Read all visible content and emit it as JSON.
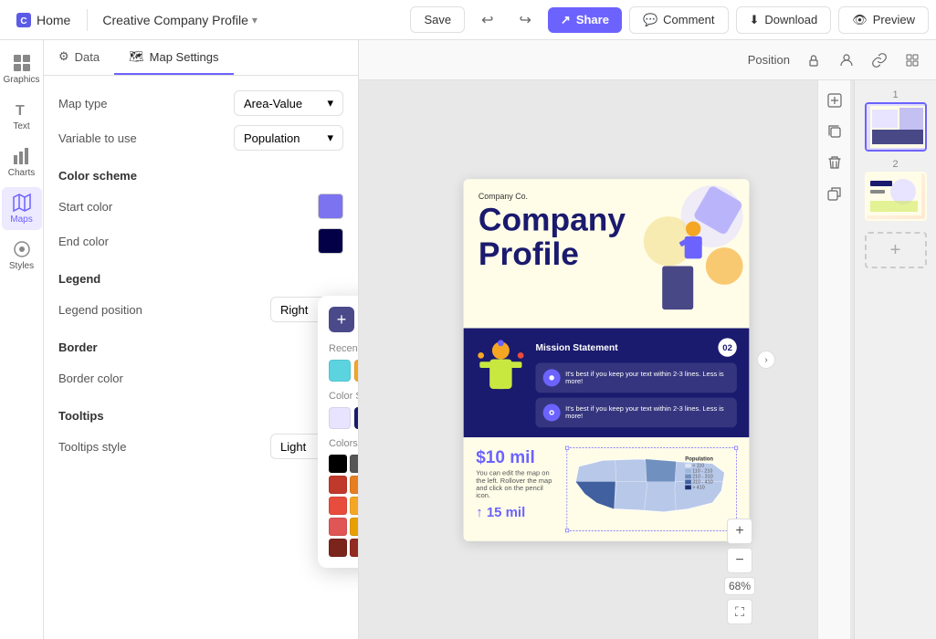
{
  "topbar": {
    "home_label": "Home",
    "title": "Creative Company Profile",
    "save_label": "Save",
    "share_label": "Share",
    "comment_label": "Comment",
    "download_label": "Download",
    "preview_label": "Preview"
  },
  "icon_sidebar": {
    "items": [
      {
        "id": "graphics",
        "label": "Graphics",
        "icon": "◻"
      },
      {
        "id": "text",
        "label": "Text",
        "icon": "T"
      },
      {
        "id": "charts",
        "label": "Charts",
        "icon": "📊"
      },
      {
        "id": "maps",
        "label": "Maps",
        "icon": "🗺"
      },
      {
        "id": "styles",
        "label": "Styles",
        "icon": "✦"
      }
    ]
  },
  "settings": {
    "tab_data": "Data",
    "tab_map_settings": "Map Settings",
    "map_type_label": "Map type",
    "map_type_value": "Area-Value",
    "variable_label": "Variable to use",
    "variable_value": "Population",
    "color_scheme_title": "Color scheme",
    "start_color_label": "Start color",
    "start_color_hex": "#7b73f0",
    "end_color_label": "End color",
    "end_color_hex": "#030047",
    "legend_title": "Legend",
    "legend_position_label": "Legend position",
    "legend_position_value": "Right",
    "border_title": "Border",
    "border_color_label": "Border color",
    "tooltips_title": "Tooltips",
    "tooltips_style_label": "Tooltips style",
    "tooltips_style_value": "Light"
  },
  "color_picker": {
    "hex_value": "#030047",
    "plus_label": "+",
    "recent_colors_label": "Recent Colors",
    "scheme_label": "Color Scheme - Original",
    "colors_label": "Colors",
    "recent": [
      "#5bd4e0",
      "#f5a623",
      "#4ecdc4",
      "#2d2d6b",
      "#7b73f0",
      "#a8d8f0"
    ],
    "scheme_colors": [
      "#e8e4ff",
      "#1a1a6e",
      "#6c63ff",
      "#f8d0e0",
      "#fffde8",
      "#f0f0f0"
    ],
    "colors_row1": [
      "#000000",
      "#555555",
      "#888888",
      "#aaaaaa",
      "#cccccc",
      "#e0e0e0",
      "#f5f5f5",
      "#ffffff"
    ],
    "colors_row2": [
      "#c0392b",
      "#e67e22",
      "#f39c12",
      "#8b6914",
      "#27ae60",
      "#1abc9c",
      "#2980b9",
      "#8e44ad"
    ],
    "colors_row3": [
      "#e74c3c",
      "#f5a623",
      "#f1c40f",
      "#d4a843",
      "#2ecc71",
      "#1dd2af",
      "#3498db",
      "#9b59b6"
    ],
    "colors_row4": [
      "#c0392b",
      "#e67e22",
      "#f39c12",
      "#8b6914",
      "#27ae60",
      "#1abc9c",
      "#2980b9",
      "#8e44ad"
    ],
    "colors_row5": [
      "#7b241c",
      "#922b21",
      "#4a235a",
      "#1a5276",
      "#145a32",
      "#0e6655",
      "#784212",
      "#6e2f1a"
    ]
  },
  "canvas": {
    "position_label": "Position",
    "zoom_value": "68%",
    "page1_num": "1",
    "page2_num": "2"
  },
  "design": {
    "company_name": "Company Co.",
    "title_line1": "Company",
    "title_line2": "Profile",
    "mission_title": "Mission Statement",
    "mission_num": "02",
    "bullet1": "It's best if you keep your text within 2-3 lines. Less is more!",
    "bullet2": "It's best if you keep your text within 2-3 lines. Less is more!",
    "amount1": "$10 mil",
    "amount1_desc": "You can edit the map on the left. Rollover the map and click on the pencil icon.",
    "amount2": "↑ 15 mil",
    "pop_label": "Population",
    "pop_110": "< 110",
    "pop_210": "110 - 210",
    "pop_310": "210 - 310",
    "pop_410": "310 - 410",
    "pop_more": "> 410"
  }
}
